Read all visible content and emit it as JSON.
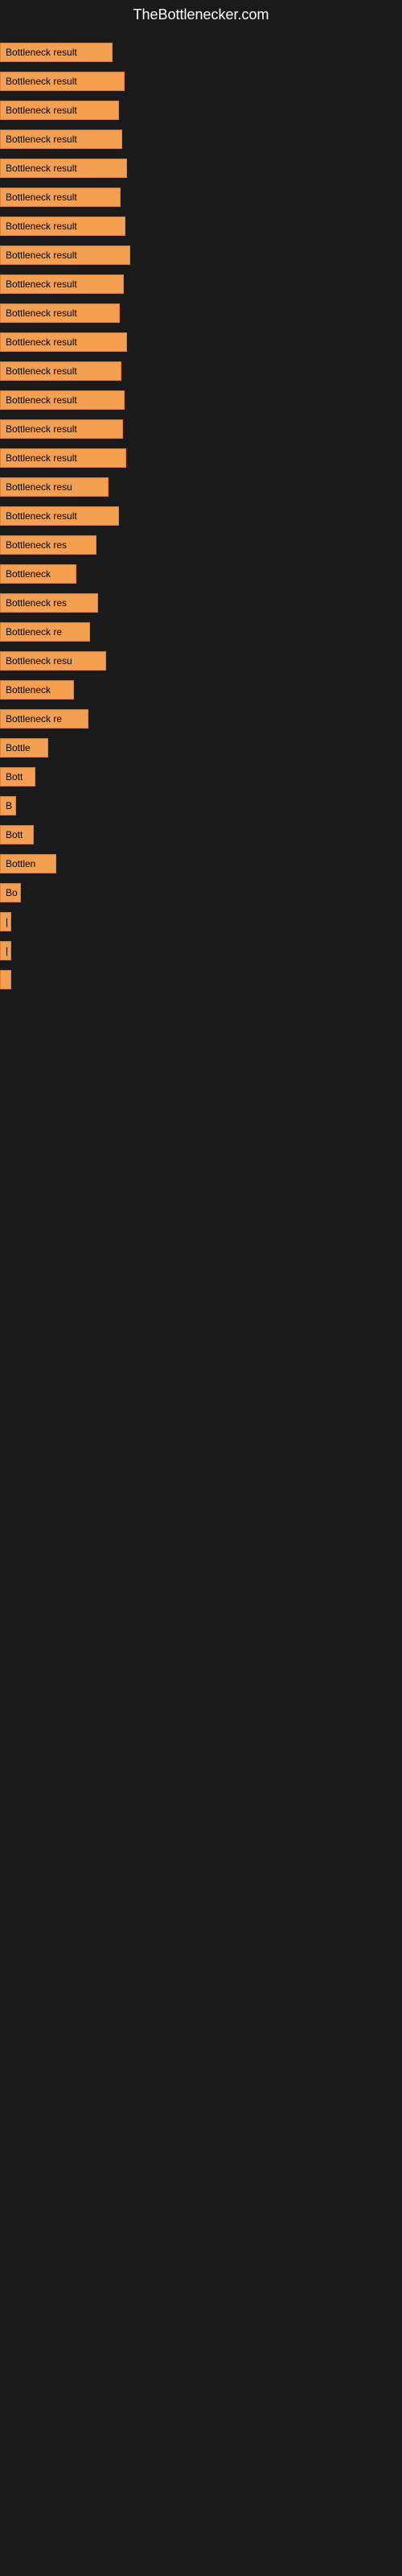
{
  "site": {
    "title": "TheBottlenecker.com"
  },
  "bars": [
    {
      "label": "Bottleneck result",
      "width": 140
    },
    {
      "label": "Bottleneck result",
      "width": 155
    },
    {
      "label": "Bottleneck result",
      "width": 148
    },
    {
      "label": "Bottleneck result",
      "width": 152
    },
    {
      "label": "Bottleneck result",
      "width": 158
    },
    {
      "label": "Bottleneck result",
      "width": 150
    },
    {
      "label": "Bottleneck result",
      "width": 156
    },
    {
      "label": "Bottleneck result",
      "width": 162
    },
    {
      "label": "Bottleneck result",
      "width": 154
    },
    {
      "label": "Bottleneck result",
      "width": 149
    },
    {
      "label": "Bottleneck result",
      "width": 158
    },
    {
      "label": "Bottleneck result",
      "width": 151
    },
    {
      "label": "Bottleneck result",
      "width": 155
    },
    {
      "label": "Bottleneck result",
      "width": 153
    },
    {
      "label": "Bottleneck result",
      "width": 157
    },
    {
      "label": "Bottleneck resu",
      "width": 135
    },
    {
      "label": "Bottleneck result",
      "width": 148
    },
    {
      "label": "Bottleneck res",
      "width": 120
    },
    {
      "label": "Bottleneck",
      "width": 95
    },
    {
      "label": "Bottleneck res",
      "width": 122
    },
    {
      "label": "Bottleneck re",
      "width": 112
    },
    {
      "label": "Bottleneck resu",
      "width": 132
    },
    {
      "label": "Bottleneck",
      "width": 92
    },
    {
      "label": "Bottleneck re",
      "width": 110
    },
    {
      "label": "Bottle",
      "width": 60
    },
    {
      "label": "Bott",
      "width": 44
    },
    {
      "label": "B",
      "width": 20
    },
    {
      "label": "Bott",
      "width": 42
    },
    {
      "label": "Bottlen",
      "width": 70
    },
    {
      "label": "Bo",
      "width": 26
    },
    {
      "label": "|",
      "width": 10
    },
    {
      "label": "|",
      "width": 8
    },
    {
      "label": "",
      "width": 6
    },
    {
      "label": "",
      "width": 0
    },
    {
      "label": "",
      "width": 0
    },
    {
      "label": "",
      "width": 0
    },
    {
      "label": "",
      "width": 0
    },
    {
      "label": "",
      "width": 0
    }
  ]
}
